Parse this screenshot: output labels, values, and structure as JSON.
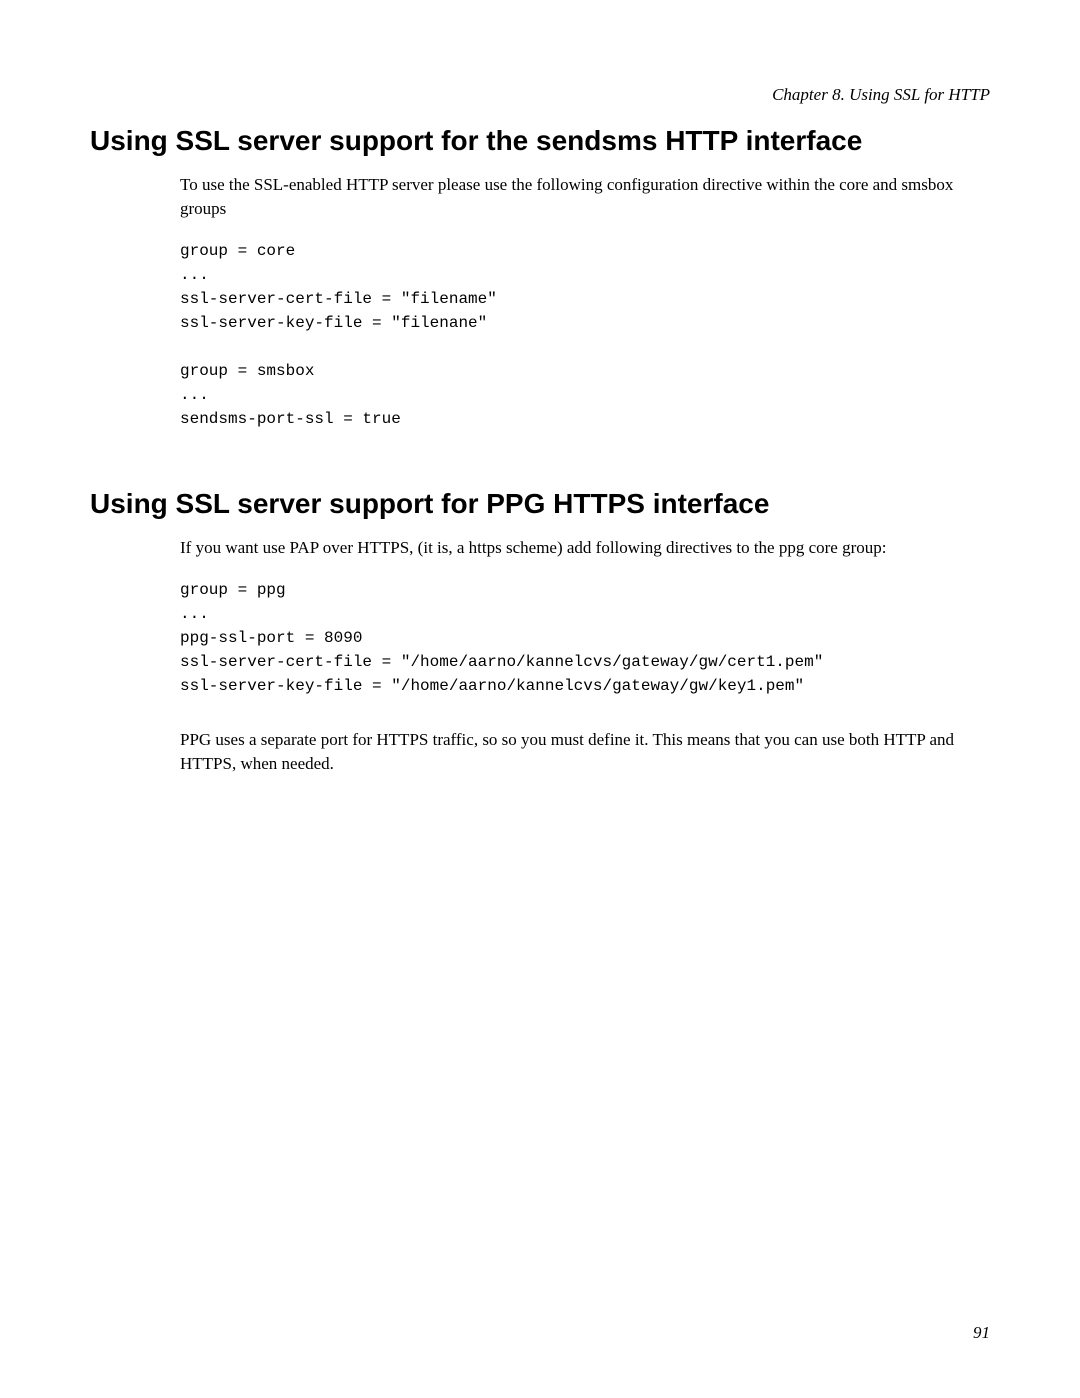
{
  "chapter_header": "Chapter 8. Using SSL for HTTP",
  "section1": {
    "heading": "Using SSL server support for the sendsms HTTP interface",
    "para1": "To use the SSL-enabled HTTP server please use the following configuration directive within the core and smsbox groups",
    "code": "group = core\n...\nssl-server-cert-file = \"filename\"\nssl-server-key-file = \"filenane\"\n\ngroup = smsbox\n...\nsendsms-port-ssl = true"
  },
  "section2": {
    "heading": "Using SSL server support for PPG HTTPS interface",
    "para1": "If you want use PAP over HTTPS, (it is, a https scheme) add following directives to the ppg core group:",
    "code": "group = ppg\n...\nppg-ssl-port = 8090\nssl-server-cert-file = \"/home/aarno/kannelcvs/gateway/gw/cert1.pem\"\nssl-server-key-file = \"/home/aarno/kannelcvs/gateway/gw/key1.pem\"",
    "para2": "PPG uses a separate port for HTTPS traffic, so so you must define it. This means that you can use both HTTP and HTTPS, when needed."
  },
  "page_number": "91"
}
